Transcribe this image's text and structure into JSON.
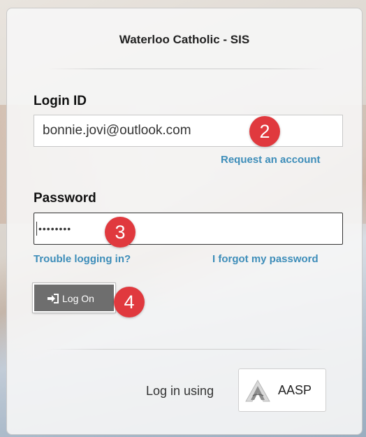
{
  "header": {
    "title": "Waterloo Catholic - SIS"
  },
  "login": {
    "login_id_label": "Login ID",
    "login_id_value": "bonnie.jovi@outlook.com",
    "request_account_link": "Request an account",
    "password_label": "Password",
    "password_value": "••••••••",
    "trouble_link": "Trouble logging in?",
    "forgot_link": "I forgot my password",
    "logon_button": "Log On"
  },
  "alt_login": {
    "prompt": "Log in using",
    "provider_button": "AASP",
    "provider_icon": "aasp-logo-icon"
  },
  "annotations": {
    "step_2": "2",
    "step_3": "3",
    "step_4": "4",
    "badge_color": "#e0393e"
  },
  "colors": {
    "link": "#3d8db9",
    "button_bg": "#6e6e6e"
  }
}
